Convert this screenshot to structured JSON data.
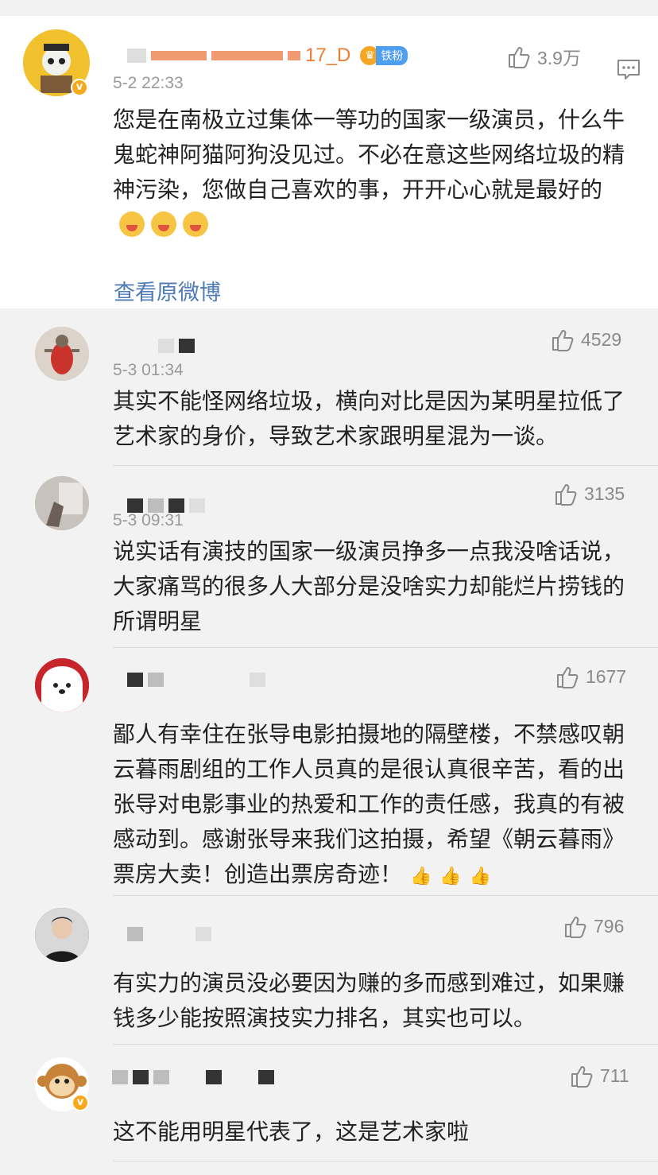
{
  "main": {
    "name_suffix": "17_D",
    "fan_badge": "铁粉",
    "time": "5-2 22:33",
    "likes": "3.9万",
    "text": "您是在南极立过集体一等功的国家一级演员，什么牛鬼蛇神阿猫阿狗没见过。不必在意这些网络垃圾的精神污染，您做自己喜欢的事，开开心心就是最好的",
    "view_original": "查看原微博"
  },
  "replies": [
    {
      "time": "5-3 01:34",
      "likes": "4529",
      "text": "其实不能怪网络垃圾，横向对比是因为某明星拉低了艺术家的身价，导致艺术家跟明星混为一谈。"
    },
    {
      "time": "5-3 09:31",
      "likes": "3135",
      "text": "说实话有演技的国家一级演员挣多一点我没啥话说，大家痛骂的很多人大部分是没啥实力却能烂片捞钱的所谓明星"
    },
    {
      "time": "",
      "likes": "1677",
      "text": "鄙人有幸住在张导电影拍摄地的隔壁楼，不禁感叹朝云暮雨剧组的工作人员真的是很认真很辛苦，看的出张导对电影事业的热爱和工作的责任感，我真的有被感动到。感谢张导来我们这拍摄，希望《朝云暮雨》票房大卖！创造出票房奇迹！"
    },
    {
      "time": "",
      "likes": "796",
      "text": "有实力的演员没必要因为赚的多而感到难过，如果赚钱多少能按照演技实力排名，其实也可以。"
    },
    {
      "time": "",
      "likes": "711",
      "text": "这不能用明星代表了，这是艺术家啦"
    }
  ],
  "icons": {
    "like": "thumbs-up-icon",
    "more": "comment-menu-icon",
    "verified": "verified-badge-icon"
  },
  "colors": {
    "link": "#4e7ab5",
    "username": "#ef7d31",
    "fan_badge": "#4f9ff0",
    "verified": "#f7a81b"
  }
}
